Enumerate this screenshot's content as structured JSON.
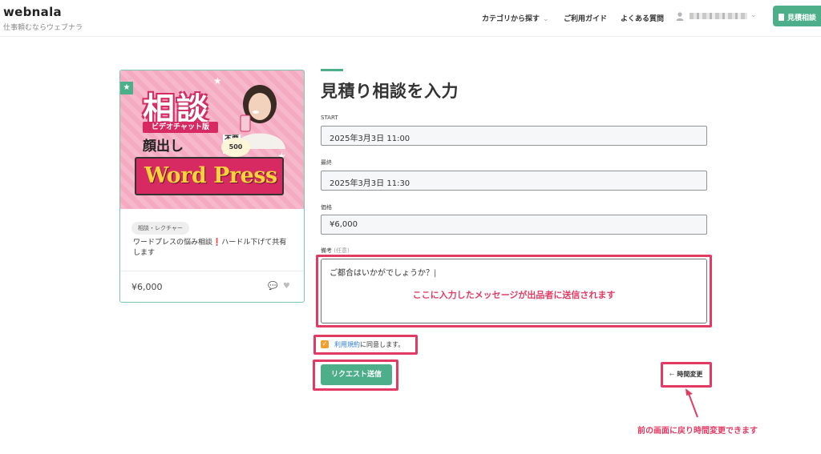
{
  "header": {
    "logo": "webnala",
    "tagline": "仕事頼むならウェブナラ",
    "nav": [
      {
        "label": "カテゴリから探す",
        "has_chevron": true
      },
      {
        "label": "ご利用ガイド",
        "has_chevron": false
      },
      {
        "label": "よくある質問",
        "has_chevron": false
      }
    ],
    "quote_button": "見積相談"
  },
  "card": {
    "banner": {
      "title": "相談",
      "video_chat": "ビデオチャット版",
      "face": "顔出し",
      "not_required": "不要",
      "count": "500",
      "wordpress": "Word Press"
    },
    "tag": "相談・レクチャー",
    "title": "ワードプレスの悩み相談",
    "title_mark": "❗",
    "title_rest": "ハードル下げて共有します",
    "price": "¥6,000"
  },
  "form": {
    "title": "見積り相談を入力",
    "fields": [
      {
        "label": "START",
        "value": "2025年3月3日 11:00"
      },
      {
        "label": "最終",
        "value": "2025年3月3日 11:30"
      },
      {
        "label": "価格",
        "value": "¥6,000"
      }
    ],
    "note_label": "備考",
    "note_optional": "(任意)",
    "note_value": "ご都合はいかがでしょうか？",
    "note_hint": "ここに入力したメッセージが出品者に送信されます",
    "terms_checked": true,
    "terms_link": "利用規約",
    "terms_text": "に同意します。",
    "submit": "リクエスト送信",
    "change_time": "時間変更",
    "callout": "前の画面に戻り時間変更できます"
  },
  "colors": {
    "accent": "#4caf8a",
    "annotation": "#e23b63",
    "checkbox": "#f0a030"
  }
}
